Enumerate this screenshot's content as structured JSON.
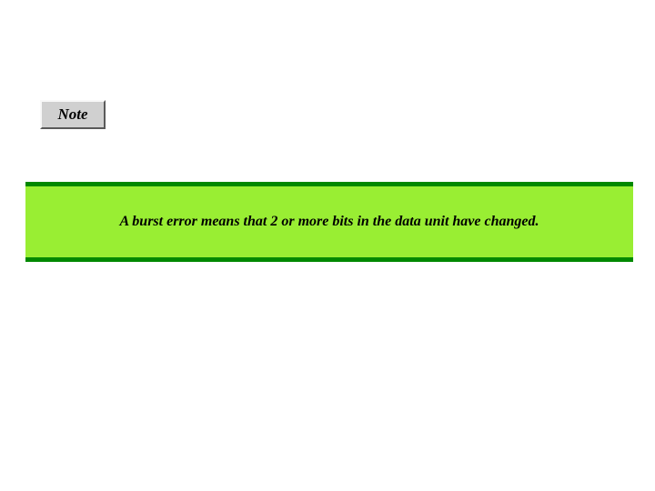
{
  "note": {
    "label": "Note"
  },
  "banner": {
    "text": "A burst error means that 2 or more bits in the data unit have changed."
  }
}
